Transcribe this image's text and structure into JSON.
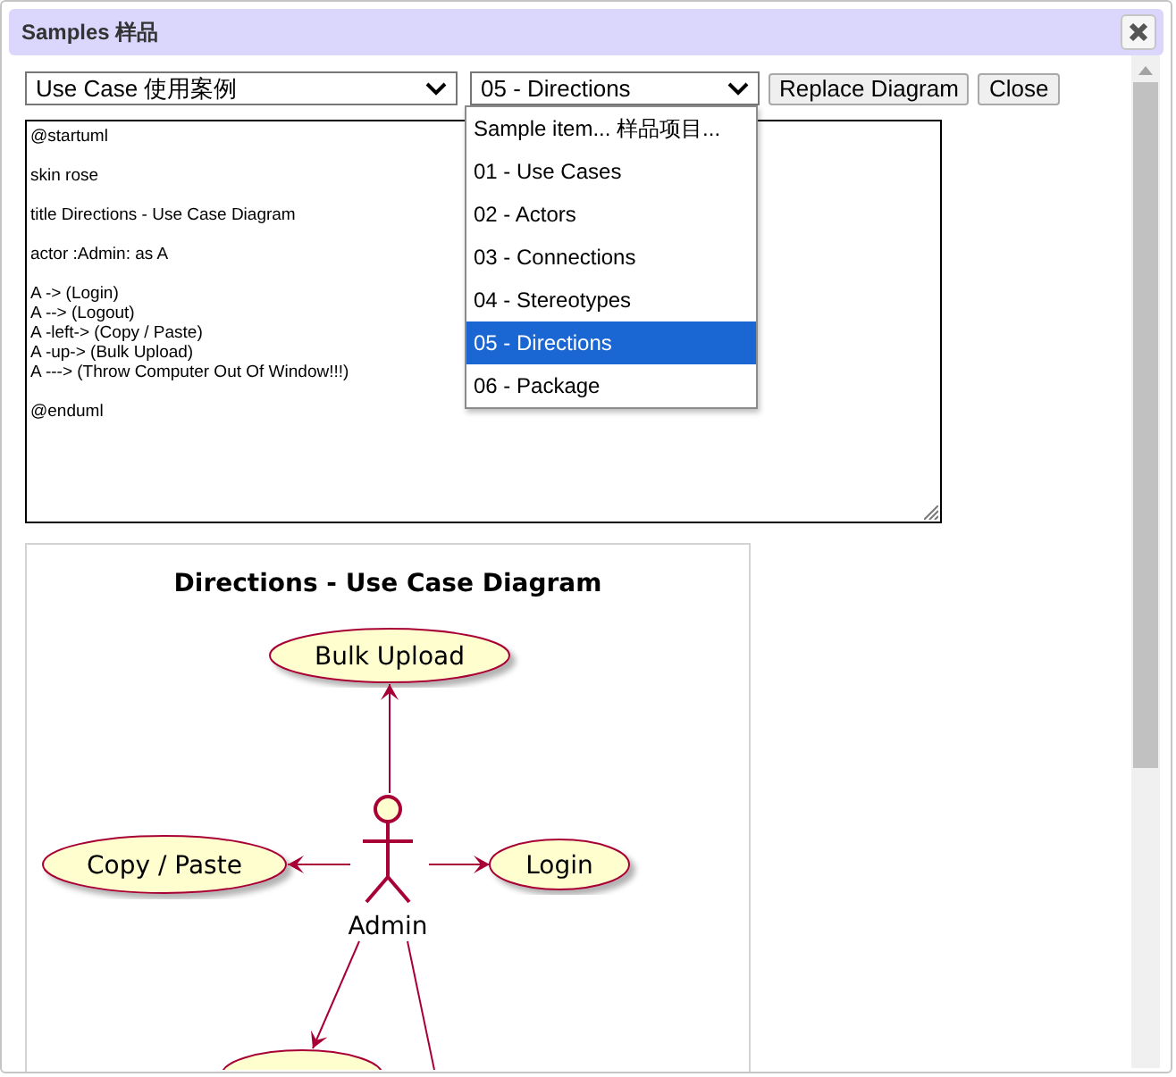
{
  "window": {
    "title": "Samples 样品"
  },
  "toolbar": {
    "category_select": {
      "value": "Use Case 使用案例"
    },
    "sample_select": {
      "value": "05 - Directions"
    },
    "buttons": [
      "Replace Diagram",
      "Close"
    ]
  },
  "dropdown": {
    "items": [
      {
        "label": "Sample item... 样品项目...",
        "selected": false
      },
      {
        "label": "01 - Use Cases",
        "selected": false
      },
      {
        "label": "02 - Actors",
        "selected": false
      },
      {
        "label": "03 - Connections",
        "selected": false
      },
      {
        "label": "04 - Stereotypes",
        "selected": false
      },
      {
        "label": "05 - Directions",
        "selected": true
      },
      {
        "label": "06 - Package",
        "selected": false
      }
    ]
  },
  "source": {
    "paragraphs": [
      [
        "@startuml"
      ],
      [
        "skin rose"
      ],
      [
        "title Directions - Use Case Diagram"
      ],
      [
        "actor :Admin: as A"
      ],
      [
        "A -> (Login)",
        "A --> (Logout)",
        "A -left-> (Copy / Paste)",
        "A -up-> (Bulk Upload)",
        "A ---> (Throw Computer Out Of Window!!!)"
      ],
      [
        "@enduml"
      ]
    ]
  },
  "diagram": {
    "title": "Directions - Use Case Diagram",
    "actor": "Admin",
    "use_cases": [
      "Bulk Upload",
      "Copy / Paste",
      "Login"
    ]
  }
}
